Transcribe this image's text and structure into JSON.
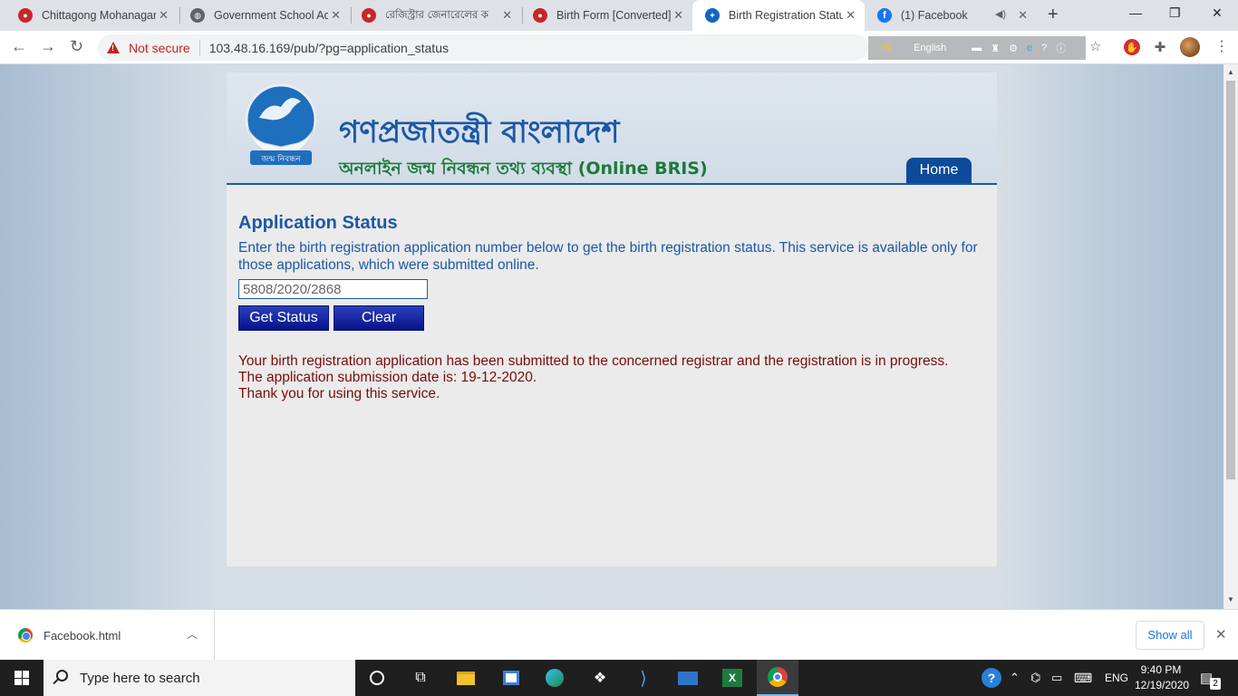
{
  "browser": {
    "tabs": [
      {
        "title": "Chittagong Mohanagar",
        "icon": "bd-gov-icon",
        "color": "#c62828"
      },
      {
        "title": "Government School Ad",
        "icon": "globe-icon",
        "color": "#5f6368"
      },
      {
        "title": "রেজিস্ট্রার জেনারেলের ক",
        "icon": "bd-gov-icon",
        "color": "#c62828"
      },
      {
        "title": "Birth Form [Converted]",
        "icon": "bd-gov-icon",
        "color": "#c62828"
      },
      {
        "title": "Birth Registration Status",
        "icon": "bris-icon",
        "color": "#1565c0"
      },
      {
        "title": "(1) Facebook",
        "icon": "facebook-icon",
        "color": "#1877f2"
      }
    ],
    "active_tab_index": 4,
    "security_label": "Not secure",
    "url": "103.48.16.169/pub/?pg=application_status",
    "extension_language": "English",
    "extension_glyph": "অ"
  },
  "header": {
    "title_bn": "গণপ্রজাতন্ত্রী বাংলাদেশ",
    "subtitle": "অনলাইন জন্ম নিবন্ধন তথ্য ব্যবস্থা (Online BRIS)",
    "logo_text": "জন্ম নিবন্ধন",
    "home_label": "Home"
  },
  "content": {
    "title": "Application Status",
    "instructions": "Enter the birth registration application number below to get the birth registration status. This service is available only for those applications, which were submitted online.",
    "application_number": "5808/2020/2868",
    "get_status_label": "Get Status",
    "clear_label": "Clear",
    "result_lines": [
      "Your birth registration application has been submitted to the concerned registrar and the registration is in progress.",
      "The application submission date is: 19-12-2020.",
      "Thank you for using this service."
    ]
  },
  "download_bar": {
    "file_name": "Facebook.html",
    "show_all_label": "Show all"
  },
  "taskbar": {
    "search_placeholder": "Type here to search",
    "language": "ENG",
    "time": "9:40 PM",
    "date": "12/19/2020",
    "notification_count": "2"
  }
}
